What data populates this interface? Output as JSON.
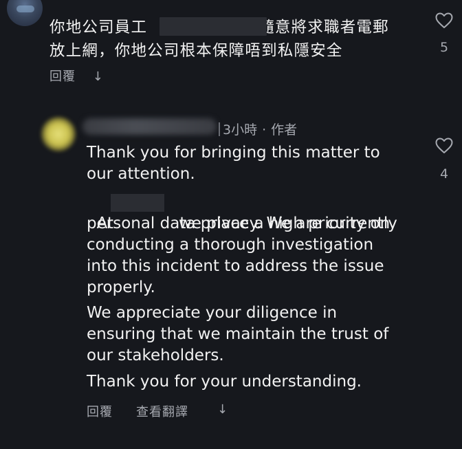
{
  "comment": {
    "line1_before_redaction": "你地公司員工",
    "line1_after_redaction": "隨意將求職者電郵",
    "line2": "放上網，你地公司根本保障唔到私隱安全",
    "reply_label": "回覆",
    "like_count": "5"
  },
  "reply": {
    "time": "3小時",
    "separator": "·",
    "author_badge": "作者",
    "paragraph1": "Thank you for bringing this matter to\nour attention.",
    "paragraph2_prefix": "At",
    "paragraph2_line1_rest": "we place a high priority on",
    "paragraph2_rest": "personal data privacy. We are currently\nconducting a thorough investigation\ninto this incident to address the issue\nproperly.",
    "paragraph3": "We appreciate your diligence in\nensuring that we maintain the trust of\nour stakeholders.",
    "paragraph4": "Thank you for your understanding.",
    "reply_label": "回覆",
    "translate_label": "查看翻譯",
    "like_count": "4"
  },
  "icons": {
    "like": "heart-outline-icon",
    "hide": "arrow-down-icon"
  },
  "colors": {
    "background": "#16181d",
    "text": "#f2f2f2",
    "muted": "#a6a9b0"
  }
}
